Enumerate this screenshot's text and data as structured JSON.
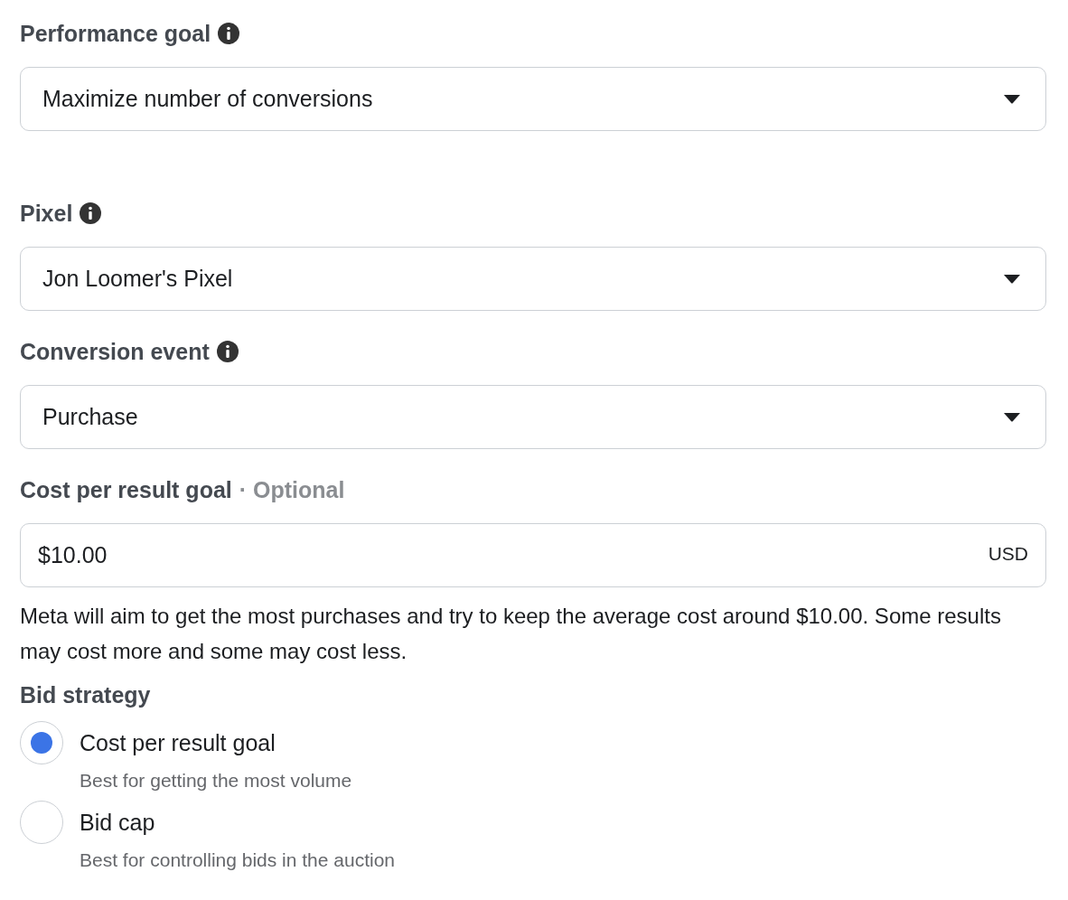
{
  "performance_goal": {
    "label": "Performance goal",
    "value": "Maximize number of conversions"
  },
  "pixel": {
    "label": "Pixel",
    "value": "Jon Loomer's Pixel"
  },
  "conversion_event": {
    "label": "Conversion event",
    "value": "Purchase"
  },
  "cost_per_result_goal": {
    "label": "Cost per result goal",
    "optional": "· Optional",
    "value": "$10.00",
    "currency": "USD",
    "help": "Meta will aim to get the most purchases and try to keep the average cost around $10.00. Some results may cost more and some may cost less."
  },
  "bid_strategy": {
    "label": "Bid strategy",
    "options": [
      {
        "label": "Cost per result goal",
        "description": "Best for getting the most volume",
        "selected": true
      },
      {
        "label": "Bid cap",
        "description": "Best for controlling bids in the auction",
        "selected": false
      }
    ]
  }
}
